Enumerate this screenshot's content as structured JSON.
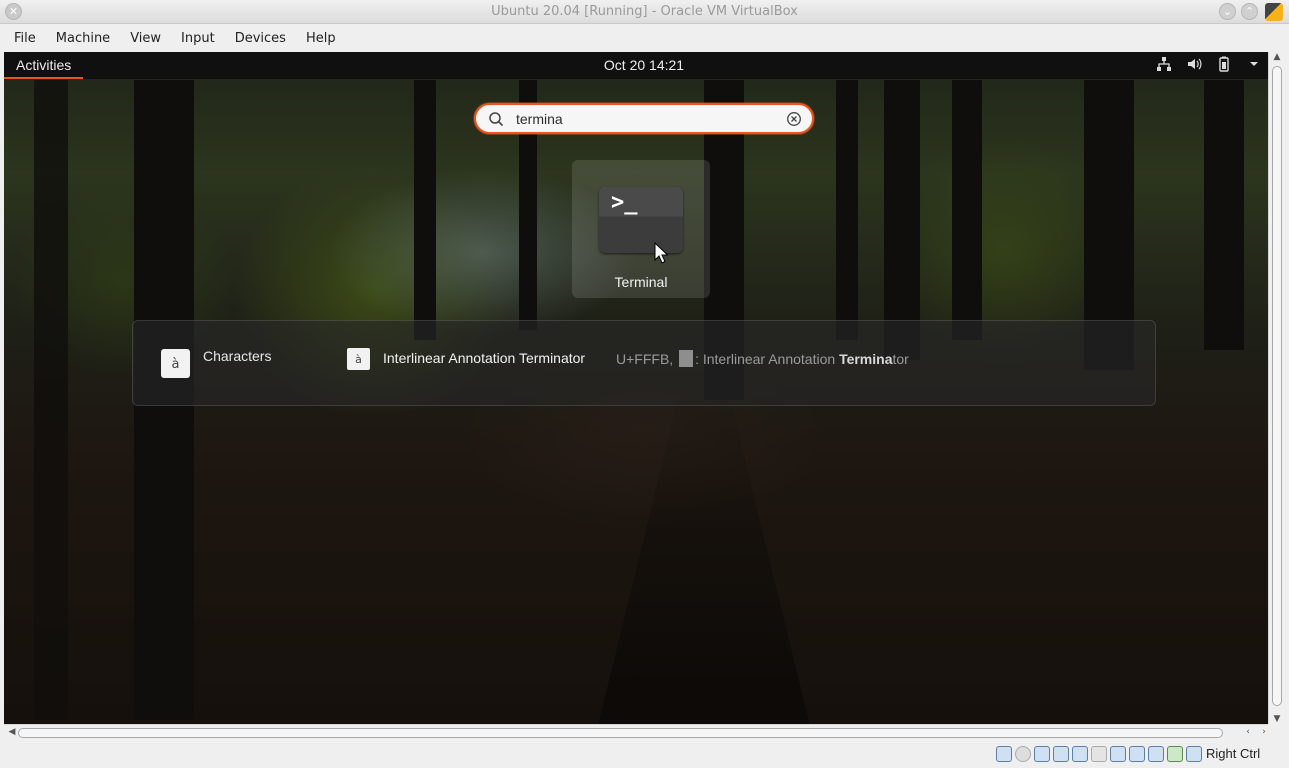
{
  "window": {
    "title": "Ubuntu 20.04 [Running] - Oracle VM VirtualBox"
  },
  "menubar": {
    "items": [
      "File",
      "Machine",
      "View",
      "Input",
      "Devices",
      "Help"
    ]
  },
  "gnome_topbar": {
    "activities_label": "Activities",
    "clock": "Oct 20  14:21",
    "tray_icons": [
      "network-icon",
      "volume-icon",
      "battery-icon",
      "menu-arrow-icon"
    ]
  },
  "search": {
    "value": "termina",
    "search_icon": "search-icon",
    "clear_icon": "clear-icon"
  },
  "app_results": [
    {
      "label": "Terminal",
      "icon": "terminal-icon",
      "prompt_glyph": ">_"
    }
  ],
  "providers": [
    {
      "name": "Characters",
      "icon_glyph": "à",
      "results": [
        {
          "icon_glyph": "à",
          "title": "Interlinear Annotation Terminator",
          "desc_prefix": "U+FFFB,",
          "desc_mid": ": Interlinear Annotation ",
          "desc_bold": "Termina",
          "desc_suffix": "tor"
        }
      ]
    }
  ],
  "statusbar": {
    "host_key": "Right Ctrl",
    "icons": [
      "hard-disk-icon",
      "optical-disk-icon",
      "audio-icon",
      "network-adapter-icon",
      "usb-icon",
      "shared-folder-icon",
      "display-icon",
      "video-capture-icon",
      "vm-icon",
      "mouse-integration-icon",
      "keyboard-capture-icon"
    ]
  },
  "colors": {
    "accent": "#e95420",
    "gnome_bar": "#101010",
    "window_chrome": "#efefef"
  }
}
